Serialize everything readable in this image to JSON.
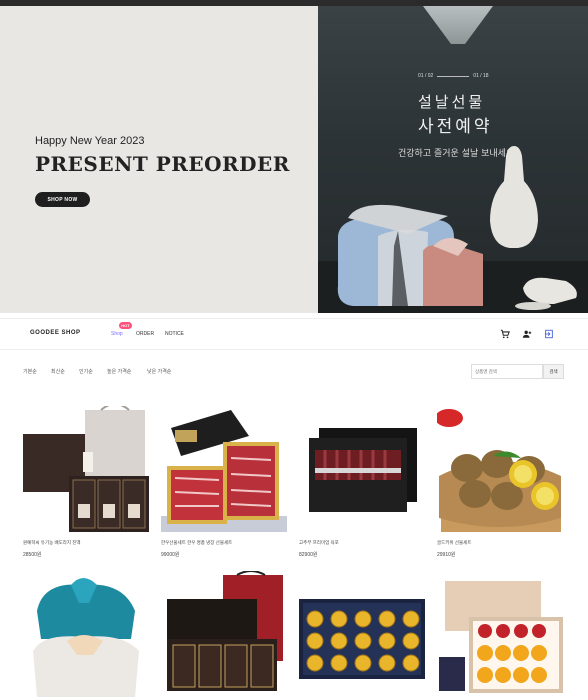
{
  "hero": {
    "subtitle": "Happy New Year 2023",
    "title": "PRESENT PREORDER",
    "button_label": "SHOP NOW",
    "date_start": "01 / 02",
    "date_end": "01 / 18",
    "kr_title_line1": "설날선물",
    "kr_title_line2": "사전예약",
    "kr_subtitle": "건강하고 즐거운 설날 보내세요"
  },
  "nav": {
    "logo": "GOODEE SHOP",
    "shop": "Shop",
    "hot_badge": "HOT",
    "order": "ORDER",
    "notice": "NOTICE",
    "icons": [
      "cart-icon",
      "add-user-icon",
      "login-icon"
    ]
  },
  "sort": {
    "options": [
      "기본순",
      "최신순",
      "인기순",
      "높은 가격순",
      "낮은 가격순"
    ],
    "search_placeholder": "상품명 검색",
    "search_button": "검색"
  },
  "products": [
    {
      "name": "원예학씨 유기농 배도라지 진액",
      "price": "28500원"
    },
    {
      "name": "한우선물세트 한우 명품 냉장 선물세트",
      "price": "99000원"
    },
    {
      "name": "고추부 프리미엄 육포",
      "price": "82900원"
    },
    {
      "name": "골드키위 선물세트",
      "price": "29910원"
    },
    {
      "name": "",
      "price": ""
    },
    {
      "name": "",
      "price": ""
    },
    {
      "name": "",
      "price": ""
    },
    {
      "name": "",
      "price": ""
    }
  ],
  "colors": {
    "accent": "#7a6cff",
    "hot_badge": "#ff4f7b",
    "hero_left_bg": "#e9e7e3",
    "hero_right_bg": "#2c3336"
  }
}
